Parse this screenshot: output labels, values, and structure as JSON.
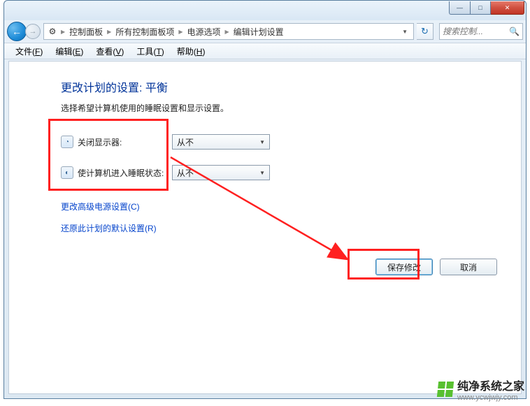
{
  "window": {
    "min": "—",
    "max": "□",
    "close": "✕"
  },
  "nav": {
    "back": "←",
    "fwd": "→",
    "refresh": "↻"
  },
  "breadcrumb": {
    "icon": "⚙",
    "items": [
      "控制面板",
      "所有控制面板项",
      "电源选项",
      "编辑计划设置"
    ],
    "sep": "▶",
    "drop": "▼"
  },
  "search": {
    "placeholder": "搜索控制...",
    "icon": "🔍"
  },
  "menu": {
    "file": "文件",
    "file_u": "F",
    "edit": "编辑",
    "edit_u": "E",
    "view": "查看",
    "view_u": "V",
    "tools": "工具",
    "tools_u": "T",
    "help": "帮助",
    "help_u": "H"
  },
  "page": {
    "title": "更改计划的设置: 平衡",
    "desc": "选择希望计算机使用的睡眠设置和显示设置。"
  },
  "settings": {
    "display": {
      "icon": "◔",
      "label": "关闭显示器:",
      "value": "从不"
    },
    "sleep": {
      "icon": "◐",
      "label": "使计算机进入睡眠状态:",
      "value": "从不"
    },
    "caret": "▼"
  },
  "links": {
    "advanced": "更改高级电源设置(C)",
    "restore": "还原此计划的默认设置(R)"
  },
  "buttons": {
    "save": "保存修改",
    "cancel": "取消"
  },
  "watermark": {
    "title": "纯净系统之家",
    "url": "www.ycwjwjy.com"
  }
}
